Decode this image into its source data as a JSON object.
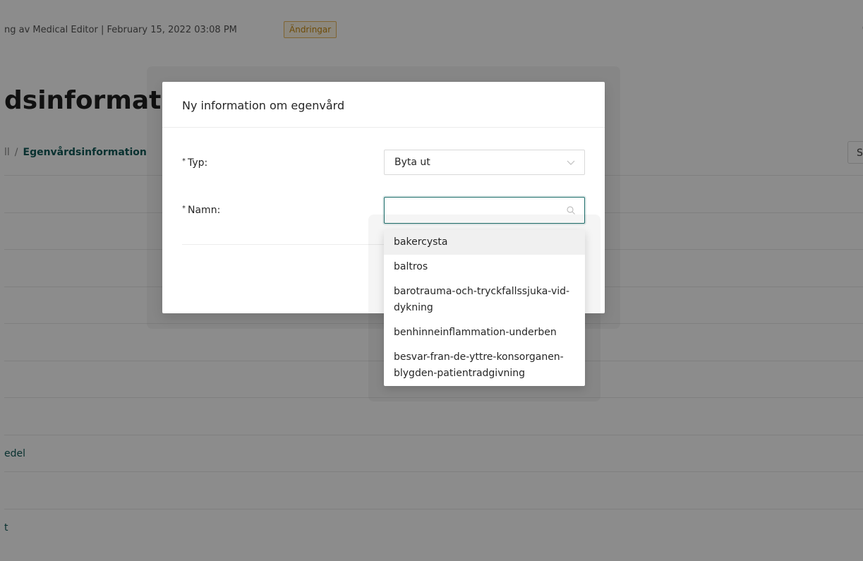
{
  "topbar": {
    "text": "ng av Medical Editor | February 15, 2022 03:08 PM",
    "badge": "Ändringar",
    "right_char": "("
  },
  "page": {
    "title": "dsinformatic",
    "breadcrumb_prev": "ll",
    "breadcrumb_sep": "/",
    "breadcrumb_current": "Egenvårdsinformation",
    "right_button": "S"
  },
  "list": {
    "rows": [
      "",
      "",
      "",
      "",
      "",
      "",
      "",
      "edel",
      "",
      "t"
    ]
  },
  "modal": {
    "title": "Ny information om egenvård",
    "required_marker": "*",
    "typ_label": "Typ:",
    "typ_value": "Byta ut",
    "namn_label": "Namn:",
    "namn_value": ""
  },
  "dropdown": {
    "options": [
      "bakercysta",
      "baltros",
      "barotrauma-och-tryckfallssjuka-vid-dykning",
      "benhinneinflammation-underben",
      "besvar-fran-de-yttre-konsorganen-blygden-patientradgivning"
    ],
    "active_index": 0
  },
  "colors": {
    "accent": "#1f6f6c",
    "badge_border": "#e7b75a",
    "badge_text": "#c98a10"
  }
}
